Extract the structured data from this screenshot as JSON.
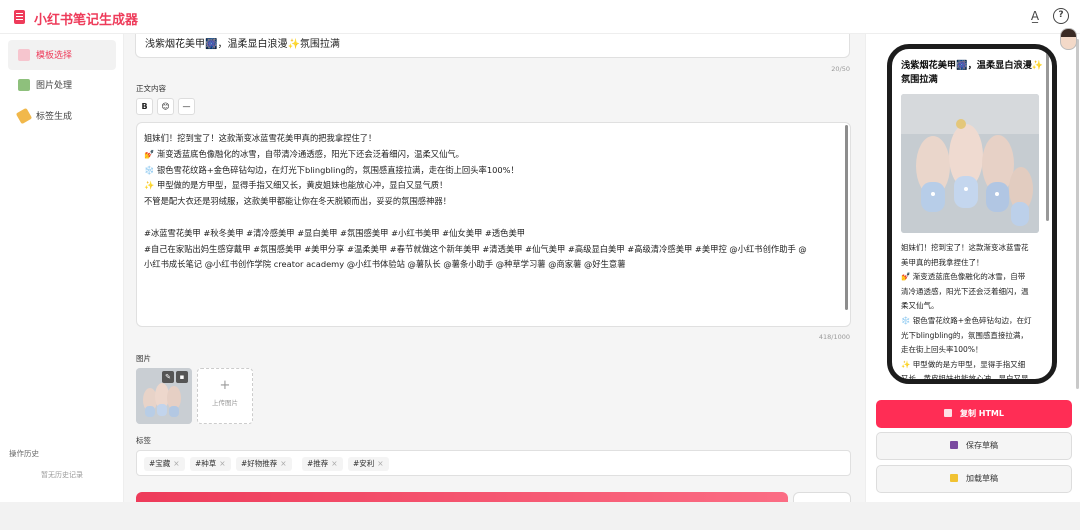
{
  "app": {
    "title": "小红书笔记生成器"
  },
  "header": {
    "translate_icon": "translate-icon",
    "help_icon": "help-icon"
  },
  "sidebar": {
    "items": [
      {
        "label": "模板选择",
        "icon": "template-icon",
        "active": true,
        "color": "#ee6b80"
      },
      {
        "label": "图片处理",
        "icon": "image-icon",
        "active": false,
        "color": "#6aa84f"
      },
      {
        "label": "标签生成",
        "icon": "tag-icon",
        "active": false,
        "color": "#e8a33b"
      }
    ],
    "history_title": "操作历史",
    "history_empty": "暂无历史记录"
  },
  "editor": {
    "title_value": "浅紫烟花美甲🎆，温柔显白浪漫✨氛围拉满",
    "title_count": "20/50",
    "body_label": "正文内容",
    "toolbar": {
      "bold": "B",
      "emoji": "😊",
      "divider": "—"
    },
    "body_lines": [
      "姐妹们！挖到宝了！这款渐变冰蓝雪花美甲真的把我拿捏住了！",
      "💅 渐变透蓝底色像融化的冰雪，自带清冷通透感，阳光下还会泛着细闪，温柔又仙气。",
      "❄️ 银色雪花纹路+金色碎钻勾边，在灯光下blingbling的，氛围感直接拉满，走在街上回头率100%！",
      "✨ 甲型做的是方甲型，显得手指又细又长，黄皮姐妹也能放心冲，显白又显气质！",
      "不管是配大衣还是羽绒服，这款美甲都能让你在冬天脱颖而出，妥妥的氛围感神器！",
      "",
      "#冰蓝雪花美甲 #秋冬美甲 #清冷感美甲 #显白美甲 #氛围感美甲 #小红书美甲 #仙女美甲 #透色美甲",
      "#自己在家贴出妈生感穿戴甲 #氛围感美甲 #美甲分享 #温柔美甲 #春节就做这个新年美甲 #清透美甲 #仙气美甲 #高级显白美甲 #高级清冷感美甲 #美甲控 @小红书创作助手 @",
      "小红书成长笔记 @小红书创作学院 creator academy @小红书体验站 @薯队长 @薯条小助手 @种草学习薯 @商家薯 @好生意薯"
    ],
    "body_count": "418/1000",
    "images_label": "图片",
    "upload_label": "上传图片",
    "tags_label": "标签",
    "tags": [
      "#宝藏",
      "#种草",
      "#好物推荐",
      "#推荐",
      "#安利"
    ],
    "accent": "#ee3b5a"
  },
  "preview": {
    "title": "浅紫烟花美甲🎆，温柔显白浪漫✨氛围拉满",
    "lines": [
      "姐妹们！挖到宝了！这款渐变冰蓝雪花",
      "美甲真的把我拿捏住了！",
      "💅 渐变透蓝底色像融化的冰雪，自带",
      "清冷通透感，阳光下还会泛着细闪，温",
      "柔又仙气。",
      "❄️ 银色雪花纹路+金色碎钻勾边，在灯",
      "光下blingbling的，氛围感直接拉满，",
      "走在街上回头率100%！",
      "✨ 甲型做的是方甲型，显得手指又细",
      "又长，黄皮姐妹也能放心冲，显白又显"
    ],
    "buttons": {
      "copy_html": "复制 HTML",
      "save_draft": "保存草稿",
      "load_draft": "加载草稿"
    }
  }
}
